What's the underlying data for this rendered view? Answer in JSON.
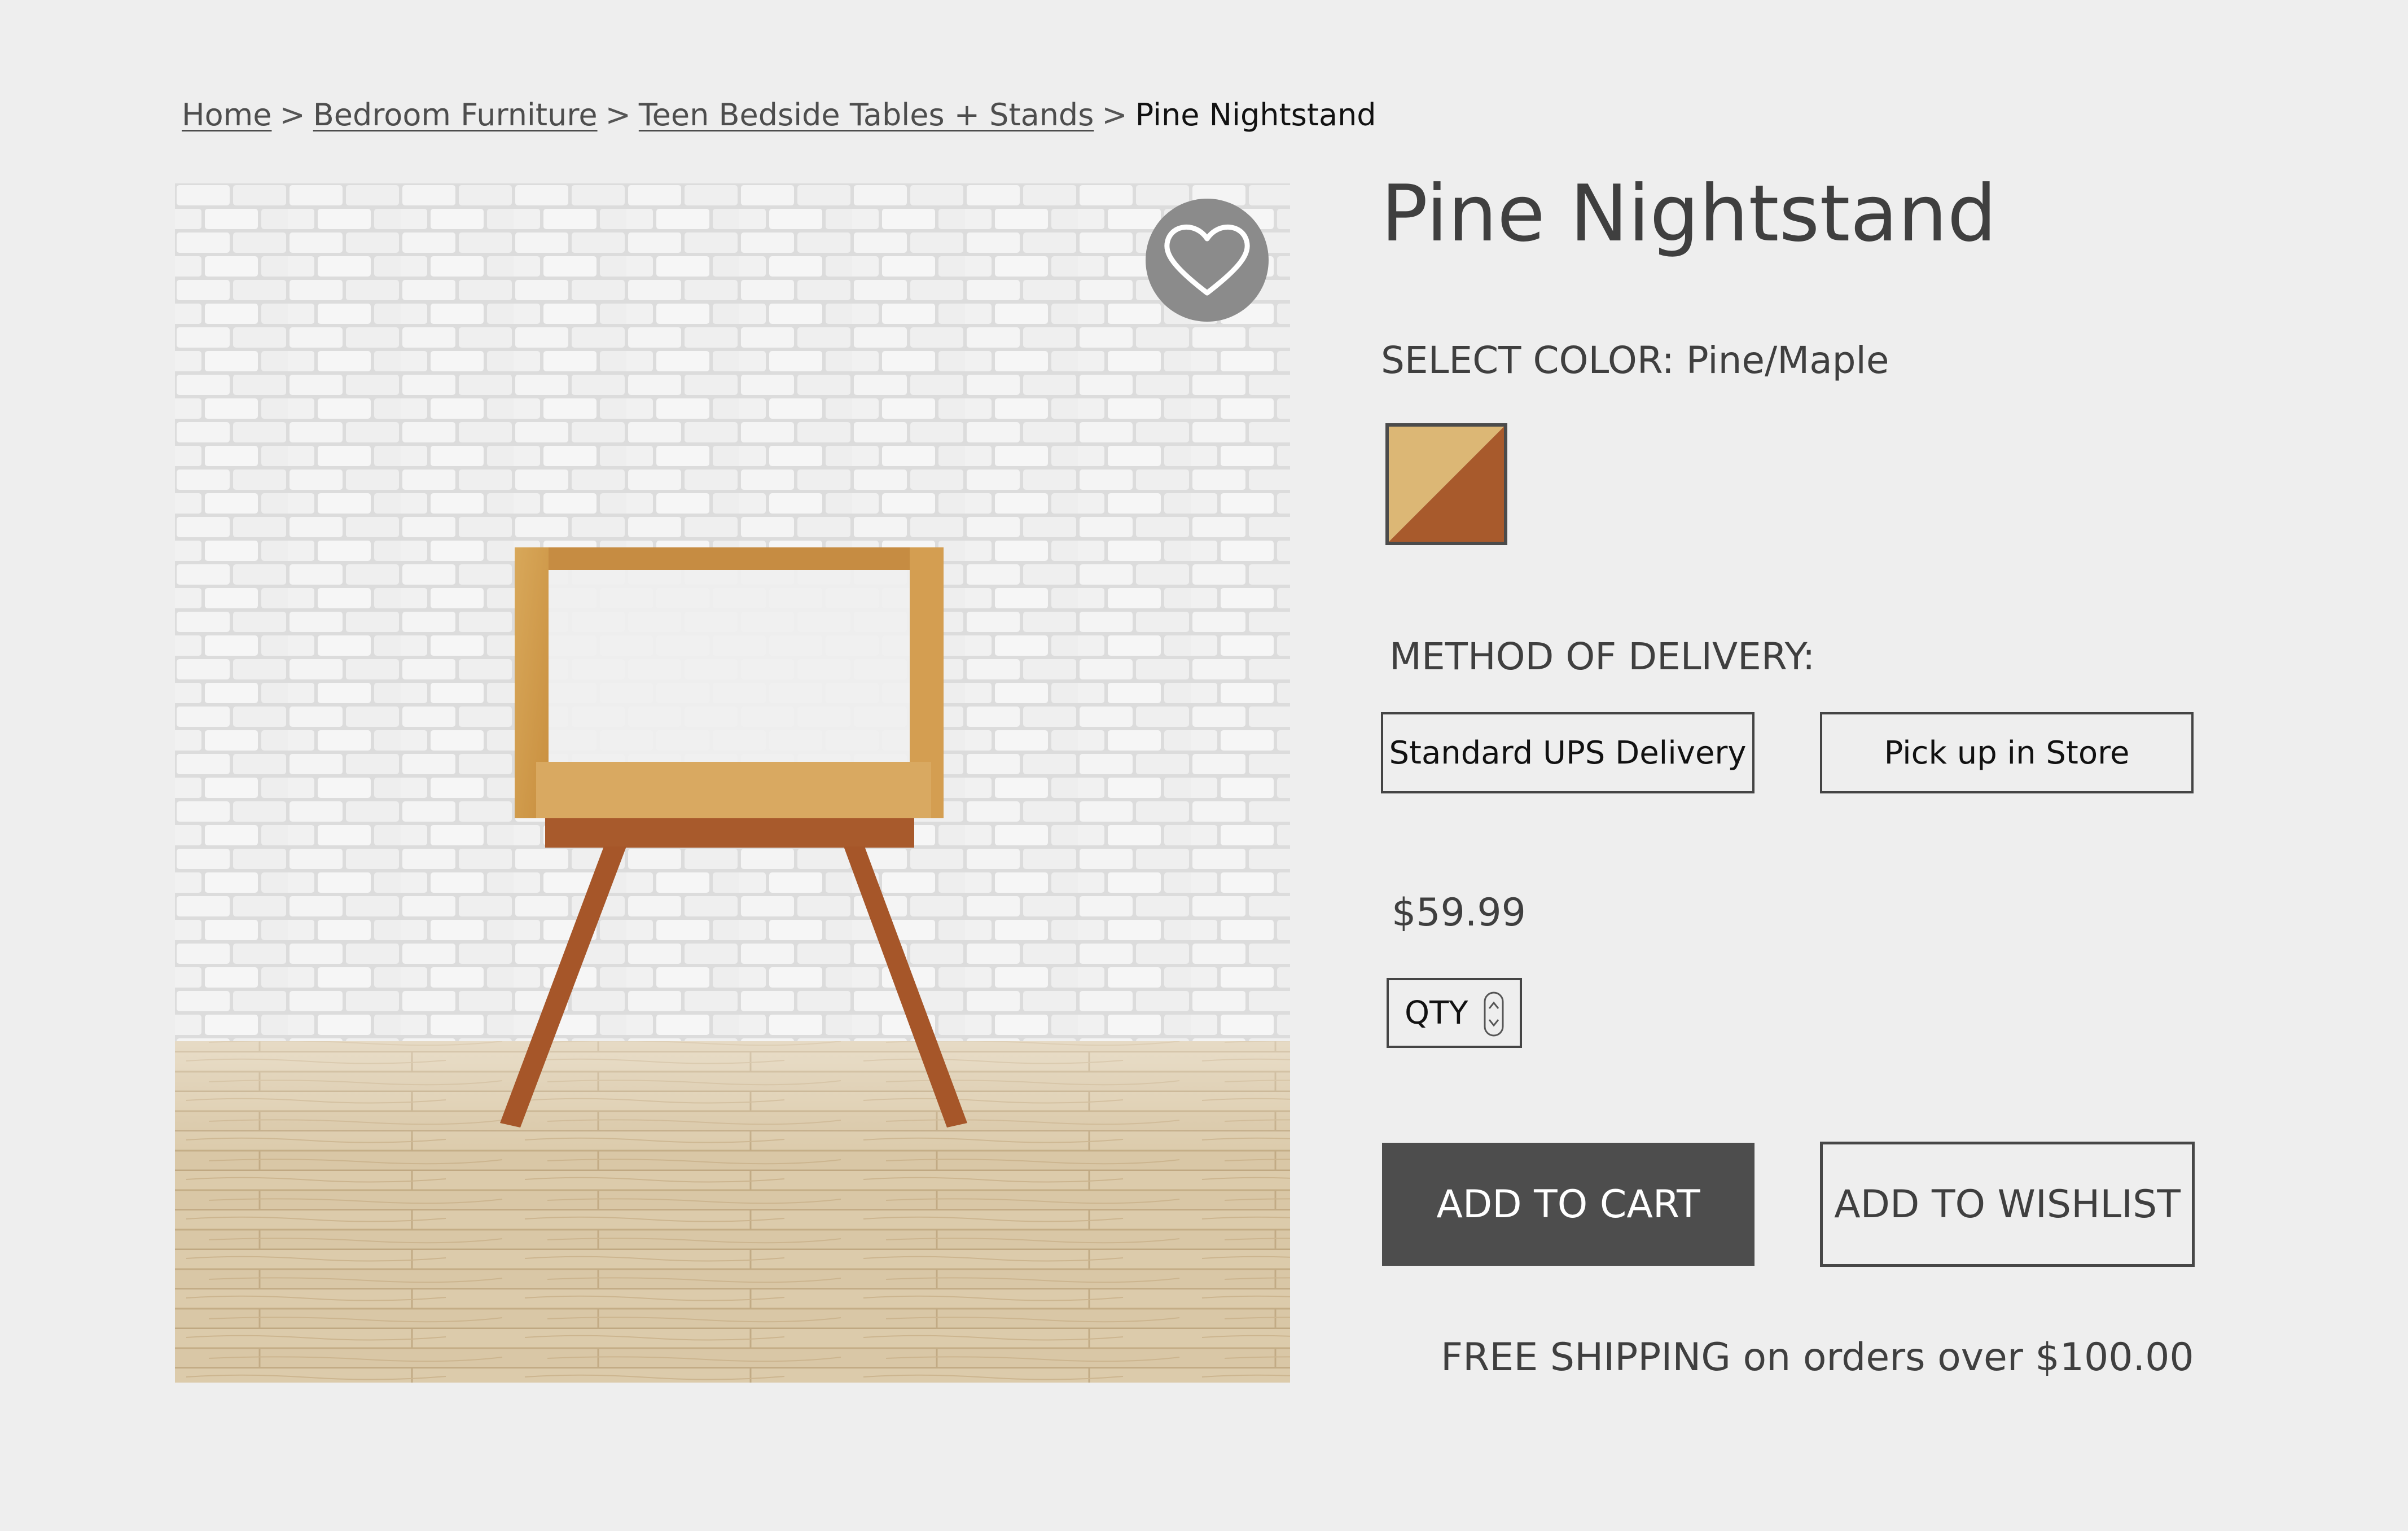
{
  "breadcrumb": {
    "items": [
      {
        "label": "Home"
      },
      {
        "label": "Bedroom Furniture"
      },
      {
        "label": "Teen Bedside Tables + Stands"
      }
    ],
    "separator": ">",
    "current": "Pine Nightstand"
  },
  "product": {
    "title": "Pine Nightstand",
    "image_alt": "Pine nightstand in front of a white brick wall",
    "favorite_icon": "heart-icon",
    "color": {
      "label": "SELECT COLOR:",
      "value": "Pine/Maple",
      "swatch_colors": [
        "#dcb775",
        "#a85a2c"
      ]
    },
    "delivery": {
      "label": "METHOD OF DELIVERY:",
      "options": [
        "Standard UPS Delivery",
        "Pick up in Store"
      ]
    },
    "price": "$59.99",
    "qty_label": "QTY",
    "add_to_cart": "ADD TO CART",
    "add_to_wishlist": "ADD TO WISHLIST",
    "shipping_note": "FREE SHIPPING on orders over $100.00"
  },
  "colors": {
    "background": "#eeeeee",
    "primary_button": "#4d4d4d",
    "text": "#3f3f3f"
  }
}
